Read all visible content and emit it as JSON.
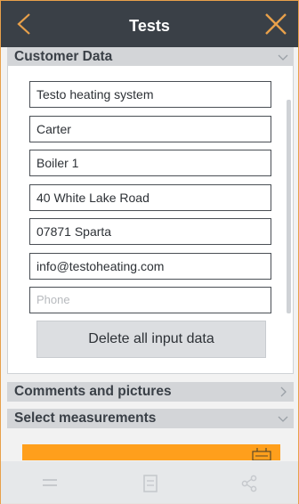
{
  "header": {
    "title": "Tests"
  },
  "sections": {
    "customer_data": "Customer Data",
    "comments": "Comments and pictures",
    "measurements": "Select measurements"
  },
  "customer": {
    "fields": [
      {
        "value": "Testo heating system"
      },
      {
        "value": "Carter"
      },
      {
        "value": "Boiler 1"
      },
      {
        "value": "40 White Lake Road"
      },
      {
        "value": "07871 Sparta"
      },
      {
        "value": "info@testoheating.com"
      }
    ],
    "phone_placeholder": "Phone",
    "delete_label": "Delete all input data"
  },
  "colors": {
    "accent": "#ff9f1c",
    "titlebar": "#3a4047",
    "section_header": "#d3d5d8"
  },
  "icons": {
    "back": "chevron-left-icon",
    "close": "close-icon",
    "section_collapse": "chevron-down-icon",
    "section_expand": "chevron-right-icon",
    "nav": [
      "menu-icon",
      "list-icon",
      "share-icon"
    ]
  }
}
